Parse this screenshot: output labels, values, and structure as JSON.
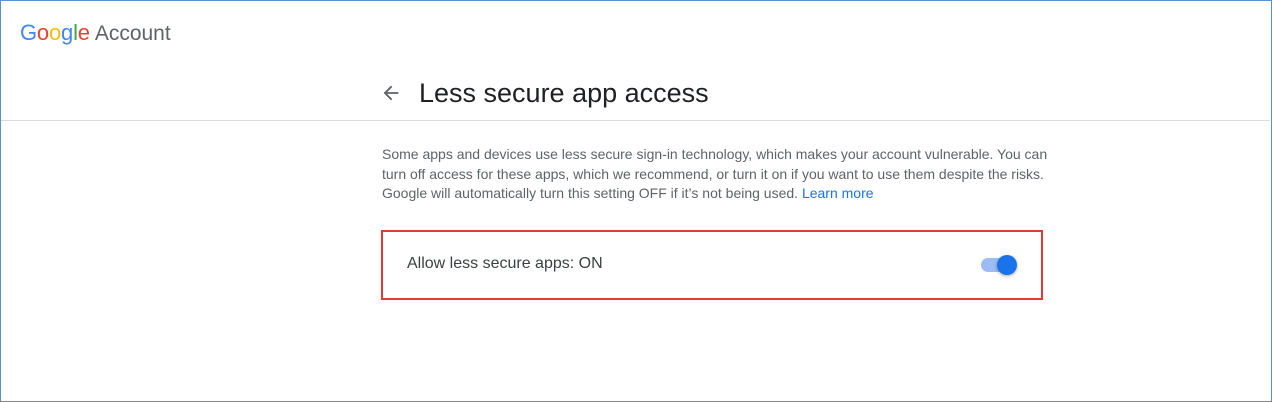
{
  "header": {
    "logo_letters": [
      {
        "char": "G",
        "color": "#4285F4"
      },
      {
        "char": "o",
        "color": "#EA4335"
      },
      {
        "char": "o",
        "color": "#FBBC05"
      },
      {
        "char": "g",
        "color": "#4285F4"
      },
      {
        "char": "l",
        "color": "#34A853"
      },
      {
        "char": "e",
        "color": "#EA4335"
      }
    ],
    "product_name": "Account"
  },
  "page": {
    "back_icon": "arrow-back-icon",
    "title": "Less secure app access"
  },
  "description": {
    "text": "Some apps and devices use less secure sign-in technology, which makes your account vulnerable. You can turn off access for these apps, which we recommend, or turn it on if you want to use them despite the risks. Google will automatically turn this setting OFF if it’s not being used.",
    "link_label": "Learn more"
  },
  "setting": {
    "label": "Allow less secure apps: ON",
    "toggle_on": true,
    "highlight_color": "#E53935"
  },
  "colors": {
    "accent": "#1A73E8",
    "accent_light": "#9DBCF3"
  }
}
